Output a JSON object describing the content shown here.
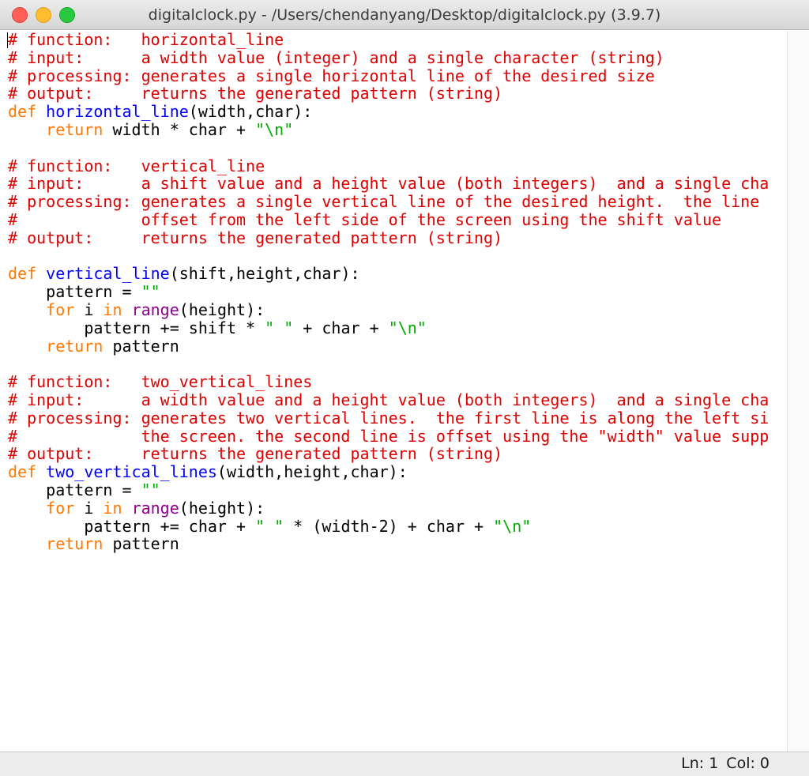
{
  "window": {
    "title": "digitalclock.py - /Users/chendanyang/Desktop/digitalclock.py (3.9.7)"
  },
  "status": {
    "line": "Ln: 1",
    "col": "Col: 0"
  },
  "colors": {
    "comment": "#dd0000",
    "keyword": "#ff7700",
    "definition": "#0000ff",
    "string": "#00aa00",
    "builtin": "#900090",
    "text": "#000000"
  },
  "code": [
    [
      [
        "cm",
        "# function:   horizontal_line"
      ]
    ],
    [
      [
        "cm",
        "# input:      a width value (integer) and a single character (string)"
      ]
    ],
    [
      [
        "cm",
        "# processing: generates a single horizontal line of the desired size"
      ]
    ],
    [
      [
        "cm",
        "# output:     returns the generated pattern (string)"
      ]
    ],
    [
      [
        "kw",
        "def"
      ],
      [
        "",
        " "
      ],
      [
        "fn",
        "horizontal_line"
      ],
      [
        "",
        "(width,char):"
      ]
    ],
    [
      [
        "",
        "    "
      ],
      [
        "kw",
        "return"
      ],
      [
        "",
        " width * char + "
      ],
      [
        "st",
        "\"\\n\""
      ]
    ],
    [],
    [
      [
        "cm",
        "# function:   vertical_line"
      ]
    ],
    [
      [
        "cm",
        "# input:      a shift value and a height value (both integers)  and a single cha"
      ]
    ],
    [
      [
        "cm",
        "# processing: generates a single vertical line of the desired height.  the line"
      ]
    ],
    [
      [
        "cm",
        "#             offset from the left side of the screen using the shift value"
      ]
    ],
    [
      [
        "cm",
        "# output:     returns the generated pattern (string)"
      ]
    ],
    [],
    [
      [
        "kw",
        "def"
      ],
      [
        "",
        " "
      ],
      [
        "fn",
        "vertical_line"
      ],
      [
        "",
        "(shift,height,char):"
      ]
    ],
    [
      [
        "",
        "    pattern = "
      ],
      [
        "st",
        "\"\""
      ]
    ],
    [
      [
        "",
        "    "
      ],
      [
        "kw",
        "for"
      ],
      [
        "",
        " i "
      ],
      [
        "kw",
        "in"
      ],
      [
        "",
        " "
      ],
      [
        "bi",
        "range"
      ],
      [
        "",
        "(height):"
      ]
    ],
    [
      [
        "",
        "        pattern += shift * "
      ],
      [
        "st",
        "\" \""
      ],
      [
        "",
        " + char + "
      ],
      [
        "st",
        "\"\\n\""
      ]
    ],
    [
      [
        "",
        "    "
      ],
      [
        "kw",
        "return"
      ],
      [
        "",
        " pattern"
      ]
    ],
    [],
    [
      [
        "cm",
        "# function:   two_vertical_lines"
      ]
    ],
    [
      [
        "cm",
        "# input:      a width value and a height value (both integers)  and a single cha"
      ]
    ],
    [
      [
        "cm",
        "# processing: generates two vertical lines.  the first line is along the left si"
      ]
    ],
    [
      [
        "cm",
        "#             the screen. the second line is offset using the \"width\" value supp"
      ]
    ],
    [
      [
        "cm",
        "# output:     returns the generated pattern (string)"
      ]
    ],
    [
      [
        "kw",
        "def"
      ],
      [
        "",
        " "
      ],
      [
        "fn",
        "two_vertical_lines"
      ],
      [
        "",
        "(width,height,char):"
      ]
    ],
    [
      [
        "",
        "    pattern = "
      ],
      [
        "st",
        "\"\""
      ]
    ],
    [
      [
        "",
        "    "
      ],
      [
        "kw",
        "for"
      ],
      [
        "",
        " i "
      ],
      [
        "kw",
        "in"
      ],
      [
        "",
        " "
      ],
      [
        "bi",
        "range"
      ],
      [
        "",
        "(height):"
      ]
    ],
    [
      [
        "",
        "        pattern += char + "
      ],
      [
        "st",
        "\" \""
      ],
      [
        "",
        " * (width-2) + char + "
      ],
      [
        "st",
        "\"\\n\""
      ]
    ],
    [
      [
        "",
        "    "
      ],
      [
        "kw",
        "return"
      ],
      [
        "",
        " pattern"
      ]
    ]
  ]
}
